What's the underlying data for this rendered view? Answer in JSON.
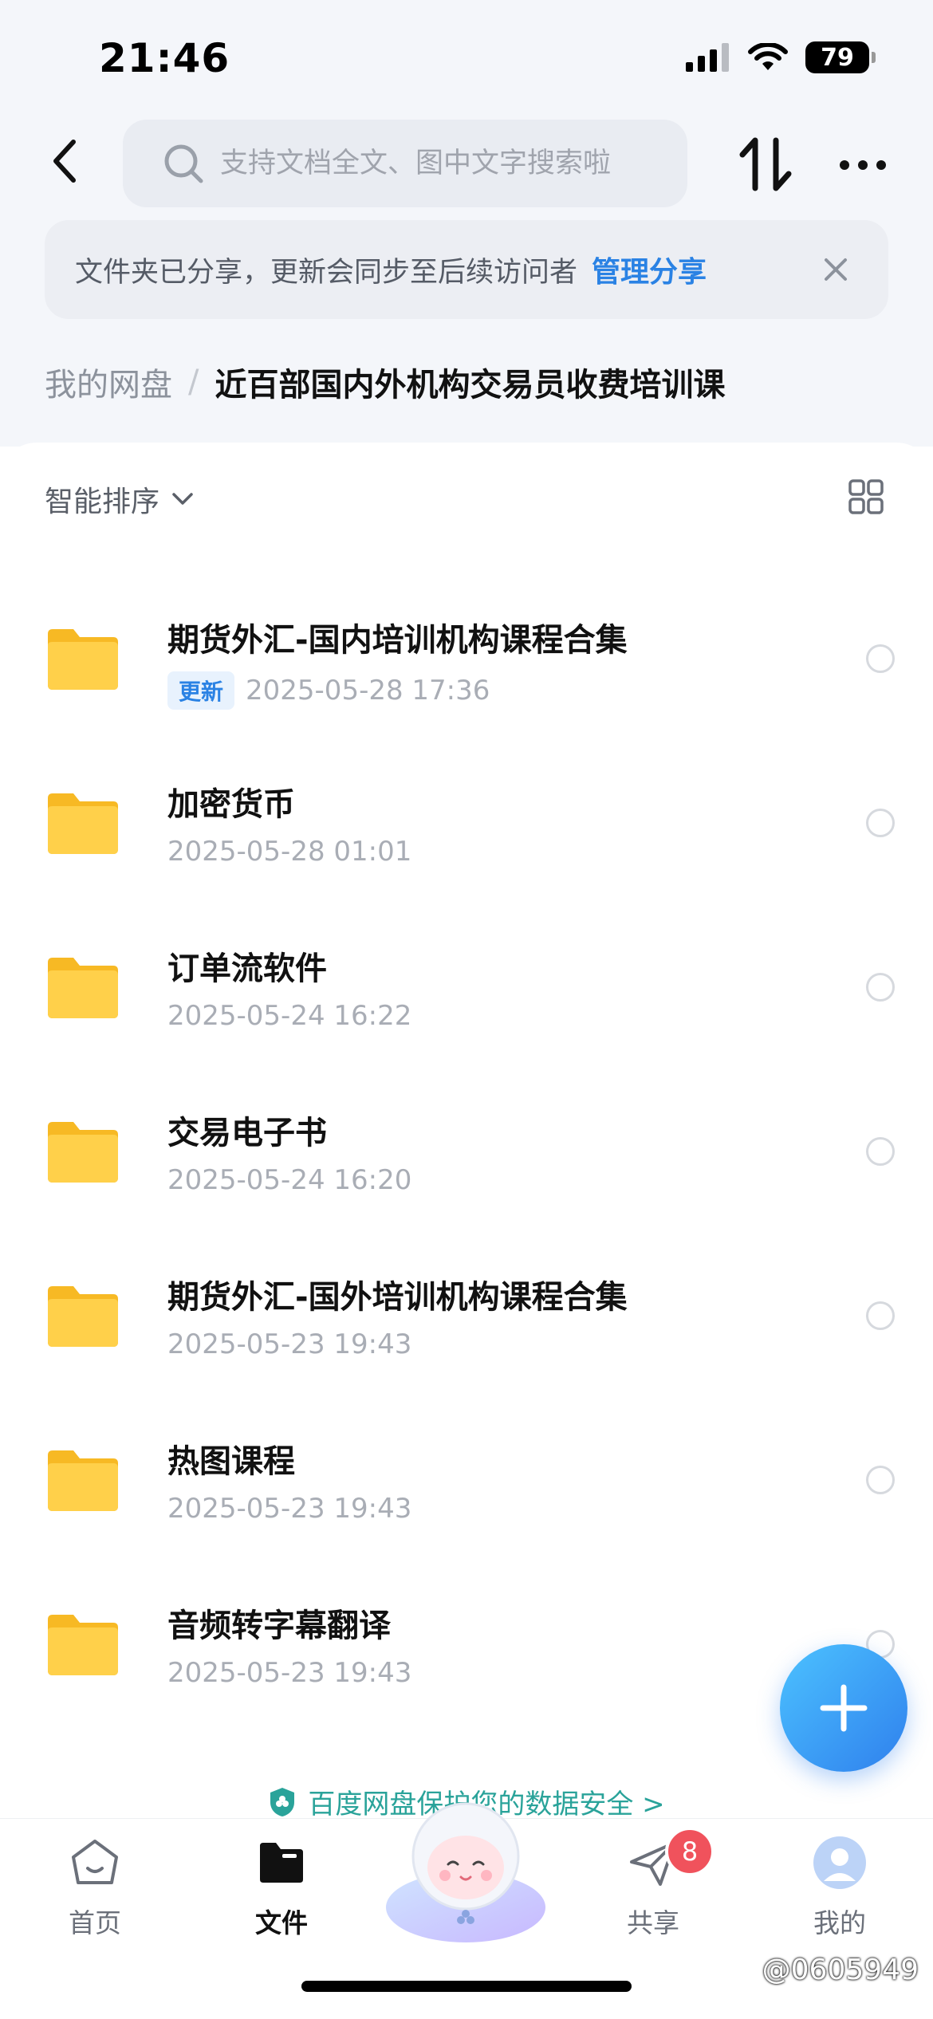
{
  "status_bar": {
    "time": "21:46",
    "battery": "79"
  },
  "header": {
    "search_placeholder": "支持文档全文、图中文字搜索啦"
  },
  "share_banner": {
    "message": "文件夹已分享，更新会同步至后续访问者",
    "action": "管理分享"
  },
  "breadcrumb": {
    "root": "我的网盘",
    "separator": "/",
    "current": "近百部国内外机构交易员收费培训课"
  },
  "sort": {
    "label": "智能排序"
  },
  "files": [
    {
      "name": "期货外汇-国内培训机构课程合集",
      "badge": "更新",
      "date": "2025-05-28 17:36"
    },
    {
      "name": "加密货币",
      "date": "2025-05-28 01:01"
    },
    {
      "name": "订单流软件",
      "date": "2025-05-24 16:22"
    },
    {
      "name": "交易电子书",
      "date": "2025-05-24 16:20"
    },
    {
      "name": "期货外汇-国外培训机构课程合集",
      "date": "2025-05-23 19:43"
    },
    {
      "name": "热图课程",
      "date": "2025-05-23 19:43"
    },
    {
      "name": "音频转字幕翻译",
      "date": "2025-05-23 19:43"
    }
  ],
  "safety_notice": "百度网盘保护您的数据安全 >",
  "bottom_nav": {
    "home": "首页",
    "files": "文件",
    "share": "共享",
    "share_badge": "8",
    "mine": "我的"
  },
  "watermark": "@0605949",
  "colors": {
    "accent": "#2a82e4",
    "folder": "#ffc83d",
    "badge_red": "#f0525c",
    "safety_green": "#2aa39a"
  }
}
